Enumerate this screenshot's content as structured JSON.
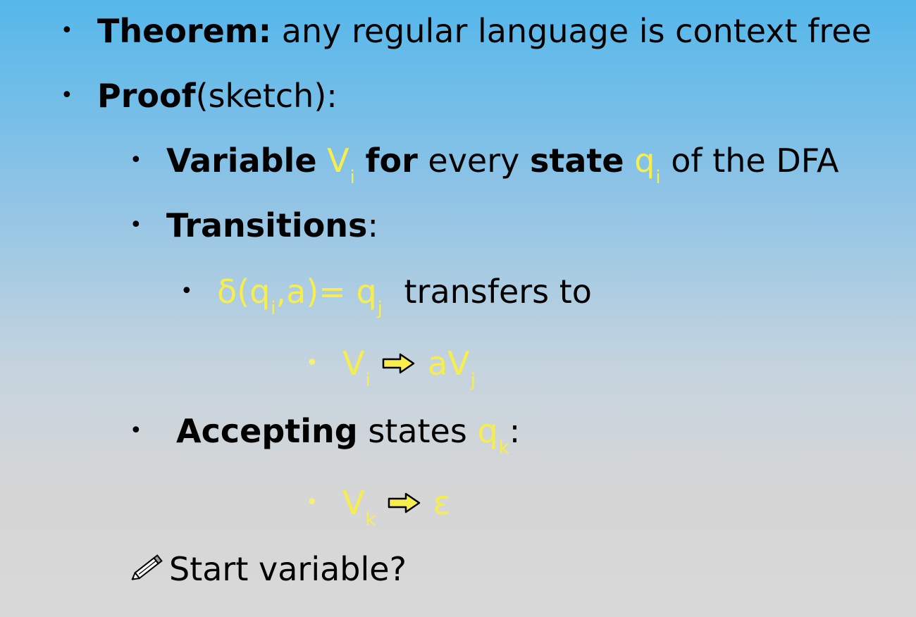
{
  "items": {
    "theorem": {
      "bullet": "•",
      "label": "Theorem:",
      "text": " any regular language is context free"
    },
    "proof": {
      "bullet": "•",
      "label": "Proof",
      "text": "(sketch):"
    },
    "variable": {
      "bullet": "•",
      "label": "Variable",
      "var": "V",
      "var_sub": "i",
      "for": "for",
      "every": " every ",
      "state": "state",
      "q": "q",
      "q_sub": "i",
      "rest": " of the DFA"
    },
    "transitions": {
      "bullet": "•",
      "label": "Transitions",
      "colon": ":"
    },
    "delta": {
      "bullet": "•",
      "expr_a": "δ(q",
      "expr_a_sub": "i",
      "expr_b": ",a)= q",
      "expr_b_sub": "j",
      "rest": "transfers to"
    },
    "rule_transition": {
      "bullet": "•",
      "lhs": "V",
      "lhs_sub": "i",
      "rhs": "aV",
      "rhs_sub": "j"
    },
    "accepting": {
      "bullet": "•",
      "label": "Accepting",
      "text": " states ",
      "q": "q",
      "q_sub": "k",
      "colon": ":"
    },
    "rule_accept": {
      "bullet": "•",
      "lhs": "V",
      "lhs_sub": "k",
      "rhs": " ε"
    },
    "start": {
      "icon": "pencil-icon",
      "text": "Start variable?"
    }
  },
  "colors": {
    "highlight": "#f7ee4e",
    "arrow_fill": "#f7ee4e",
    "arrow_stroke": "#000000"
  }
}
